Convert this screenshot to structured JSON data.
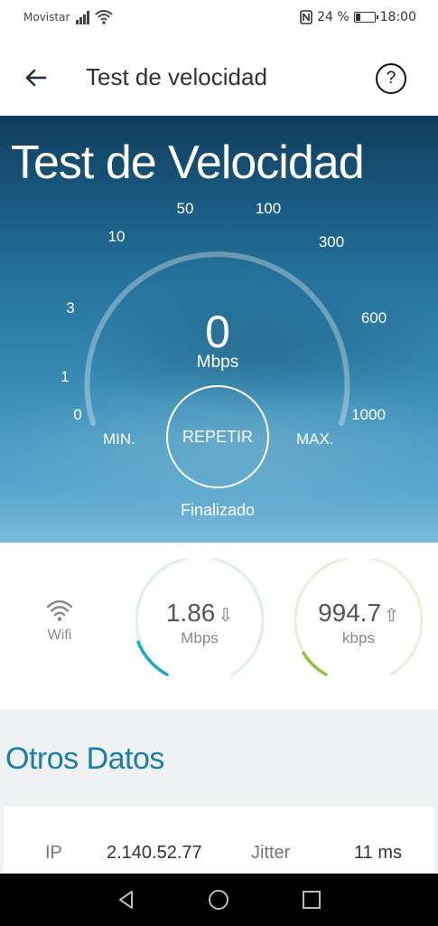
{
  "status_bar": {
    "carrier": "Movistar",
    "battery": "24 %",
    "time": "18:00"
  },
  "app_bar": {
    "title": "Test de velocidad",
    "help_label": "?"
  },
  "hero": {
    "title": "Test de Velocidad",
    "gauge_ticks": [
      "0",
      "1",
      "3",
      "10",
      "50",
      "100",
      "300",
      "600",
      "1000"
    ],
    "speed_value": "0",
    "speed_unit": "Mbps",
    "min_label": "MIN.",
    "max_label": "MAX.",
    "repeat_label": "REPETIR",
    "status": "Finalizado"
  },
  "results": {
    "connection_label": "Wifi",
    "download": {
      "value": "1.86",
      "unit": "Mbps",
      "arrow": "⇩",
      "color": "#1aa9c9",
      "track_color": "#d8eef4"
    },
    "upload": {
      "value": "994.7",
      "unit": "kbps",
      "arrow": "⇧",
      "color": "#8cc63f",
      "track_color": "#e8f0d6"
    }
  },
  "other_data": {
    "heading": "Otros Datos",
    "ip_label": "IP",
    "ip_value": "2.140.52.77",
    "jitter_label": "Jitter",
    "jitter_value": "11 ms"
  },
  "colors": {
    "accent": "#1a7ea8",
    "hero_top": "#0f3d5c",
    "hero_bottom": "#7cbbdc"
  }
}
